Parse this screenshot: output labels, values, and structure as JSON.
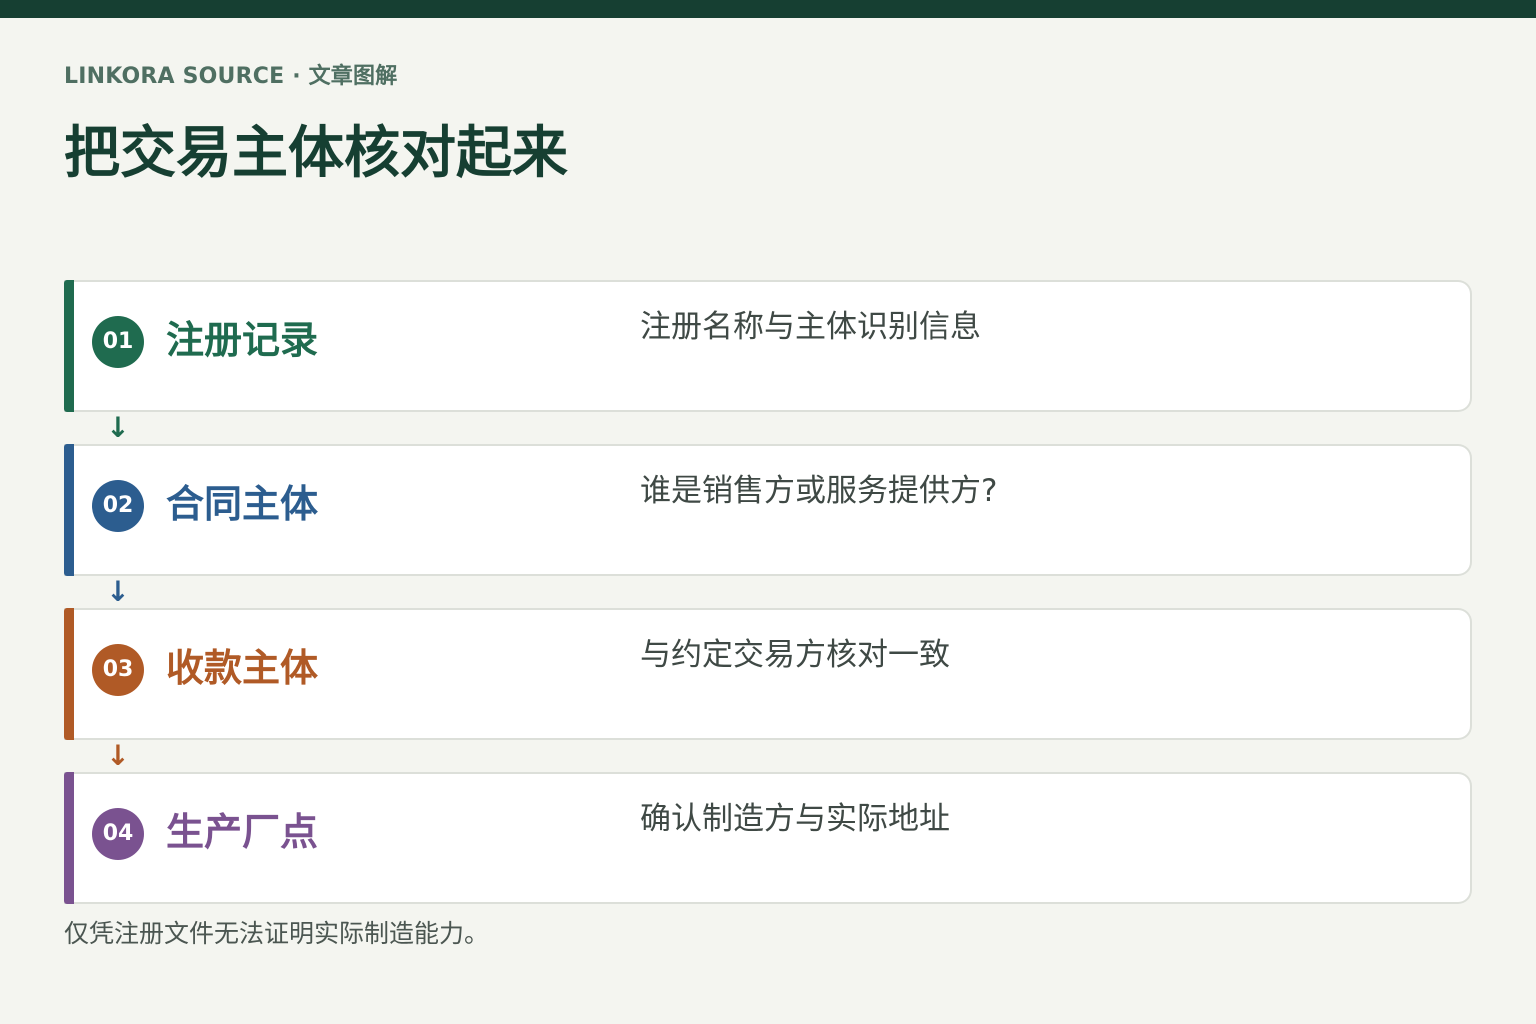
{
  "header": {
    "eyebrow": "LINKORA SOURCE · 文章图解",
    "title": "把交易主体核对起来"
  },
  "colors": {
    "background": "#f4f5f0",
    "top_bar": "#163f32",
    "title": "#163f32"
  },
  "steps": [
    {
      "number": "01",
      "label": "注册记录",
      "description": "注册名称与主体识别信息",
      "color": "#1f6b4f"
    },
    {
      "number": "02",
      "label": "合同主体",
      "description": "谁是销售方或服务提供方?",
      "color": "#2c5d8f"
    },
    {
      "number": "03",
      "label": "收款主体",
      "description": "与约定交易方核对一致",
      "color": "#b05a26"
    },
    {
      "number": "04",
      "label": "生产厂点",
      "description": "确认制造方与实际地址",
      "color": "#7a5290"
    }
  ],
  "connectors": [
    {
      "icon": "arrow-down-icon",
      "glyph": "↓",
      "color": "#1f6b4f"
    },
    {
      "icon": "arrow-down-icon",
      "glyph": "↓",
      "color": "#2c5d8f"
    },
    {
      "icon": "arrow-down-icon",
      "glyph": "↓",
      "color": "#b05a26"
    }
  ],
  "footnote": "仅凭注册文件无法证明实际制造能力。"
}
